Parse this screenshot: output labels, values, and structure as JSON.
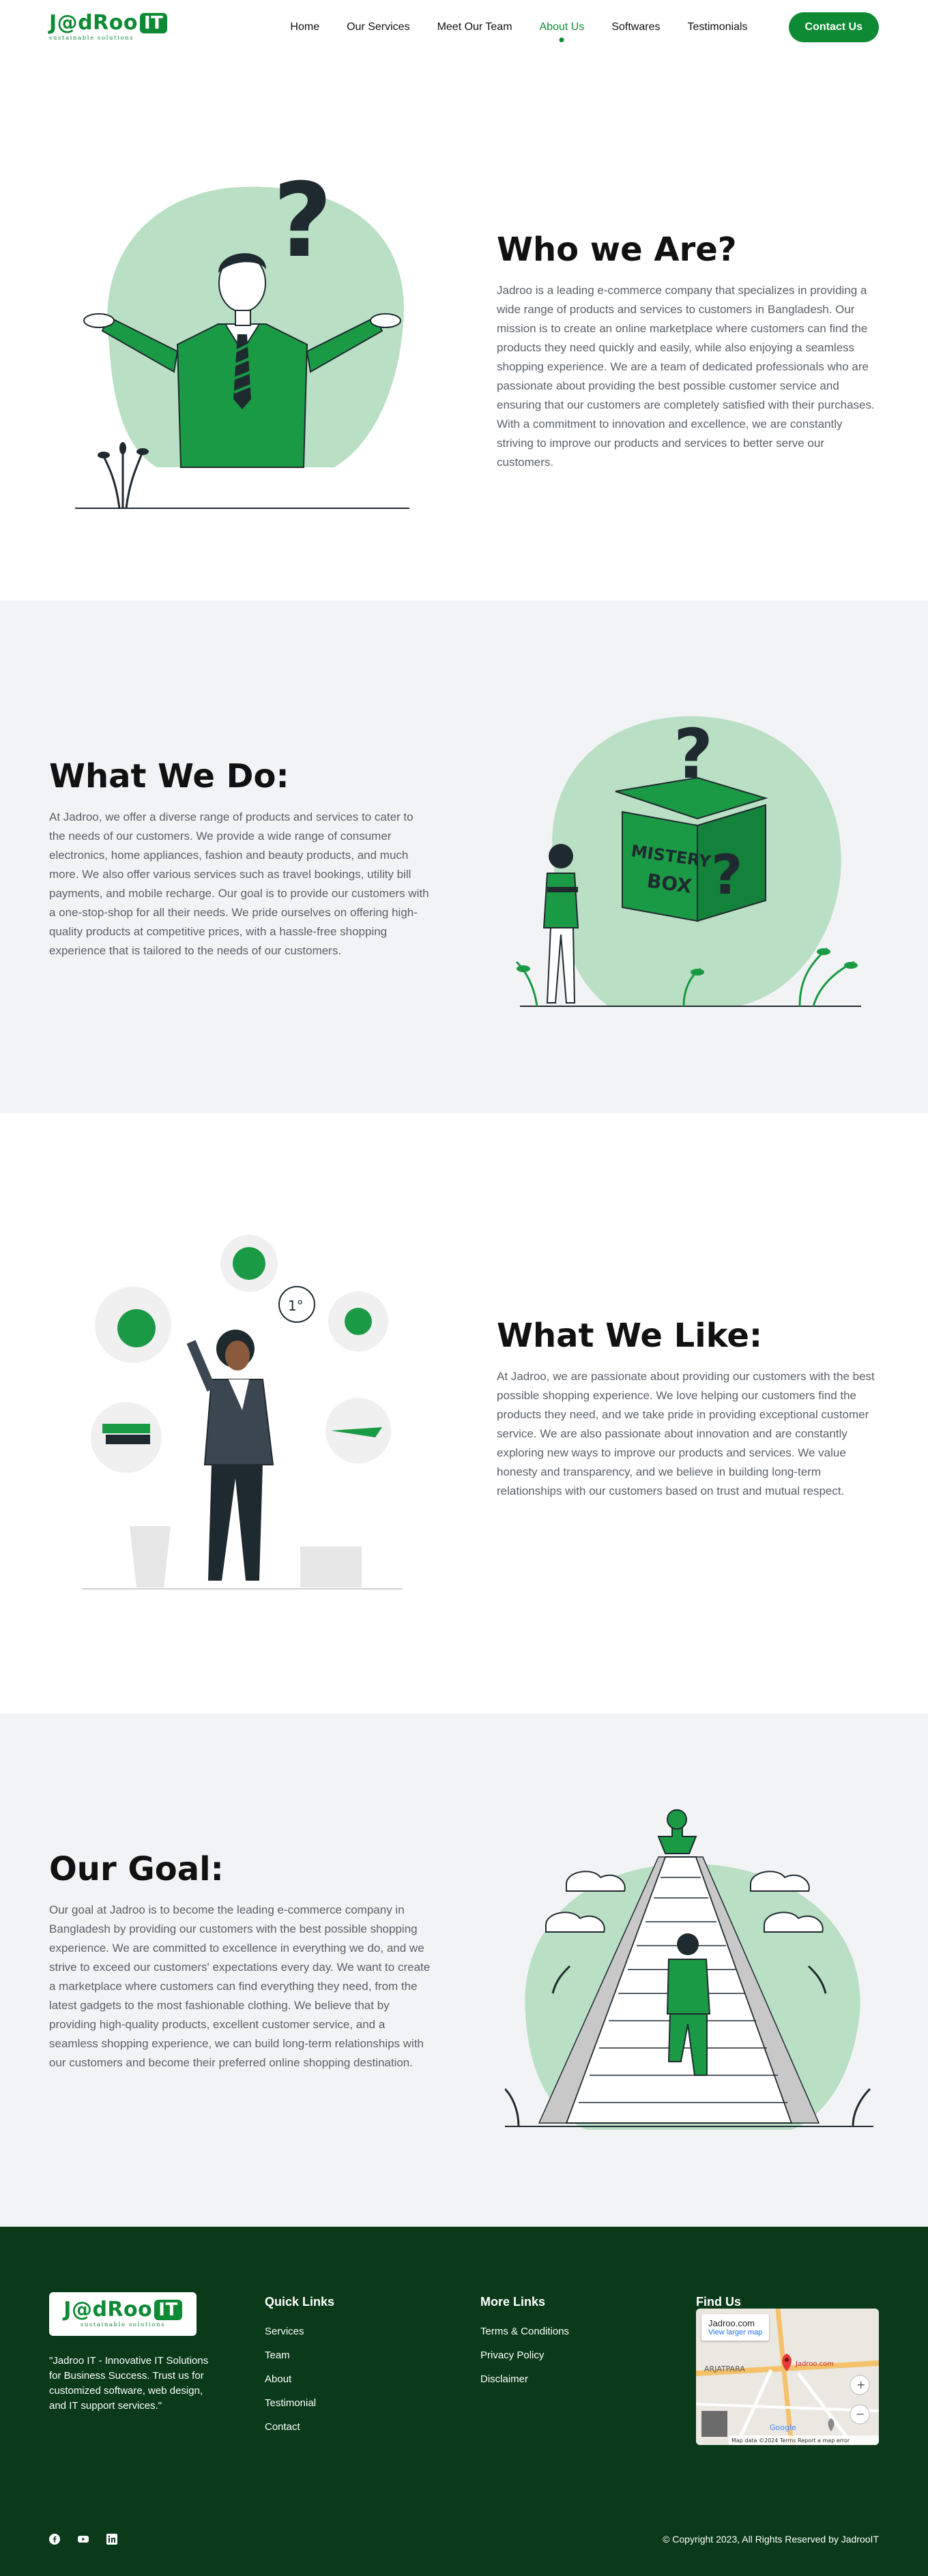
{
  "nav": {
    "logo_main": "J@dRoo",
    "logo_it": "IT",
    "logo_sub": "sustainable solutions",
    "links": [
      {
        "label": "Home"
      },
      {
        "label": "Our Services"
      },
      {
        "label": "Meet Our Team"
      },
      {
        "label": "About Us",
        "active": true
      },
      {
        "label": "Softwares"
      },
      {
        "label": "Testimonials"
      }
    ],
    "contact_button": "Contact Us"
  },
  "sections": {
    "who": {
      "title": "Who we Are?",
      "body": "Jadroo is a leading e-commerce company that specializes in providing a wide range of products and services to customers in Bangladesh. Our mission is to create an online marketplace where customers can find the products they need quickly and easily, while also enjoying a seamless shopping experience. We are a team of dedicated professionals who are passionate about providing the best possible customer service and ensuring that our customers are completely satisfied with their purchases. With a commitment to innovation and excellence, we are constantly striving to improve our products and services to better serve our customers."
    },
    "what_do": {
      "title": "What We Do:",
      "body": "At Jadroo, we offer a diverse range of products and services to cater to the needs of our customers. We provide a wide range of consumer electronics, home appliances, fashion and beauty products, and much more. We also offer various services such as travel bookings, utility bill payments, and mobile recharge. Our goal is to provide our customers with a one-stop-shop for all their needs. We pride ourselves on offering high-quality products at competitive prices, with a hassle-free shopping experience that is tailored to the needs of our customers.",
      "box_text_1": "MISTERY",
      "box_text_2": "BOX"
    },
    "what_like": {
      "title": "What We Like:",
      "body": "At Jadroo, we are passionate about providing our customers with the best possible shopping experience. We love helping our customers find the products they need, and we take pride in providing exceptional customer service. We are also passionate about innovation and are constantly exploring new ways to improve our products and services. We value honesty and transparency, and we believe in building long-term relationships with our customers based on trust and mutual respect.",
      "temp_label": "1°"
    },
    "goal": {
      "title": "Our Goal:",
      "body": "Our goal at Jadroo is to become the leading e-commerce company in Bangladesh by providing our customers with the best possible shopping experience. We are committed to excellence in everything we do, and we strive to exceed our customers' expectations every day. We want to create a marketplace where customers can find everything they need, from the latest gadgets to the most fashionable clothing. We believe that by providing high-quality products, excellent customer service, and a seamless shopping experience, we can build long-term relationships with our customers and become their preferred online shopping destination."
    }
  },
  "footer": {
    "description": "\"Jadroo IT - Innovative IT Solutions for Business Success. Trust us for customized software, web design, and IT support services.\"",
    "quick_links_title": "Quick Links",
    "quick_links": [
      "Services",
      "Team",
      "About",
      "Testimonial",
      "Contact"
    ],
    "more_links_title": "More Links",
    "more_links": [
      "Terms & Conditions",
      "Privacy Policy",
      "Disclaimer"
    ],
    "find_us_title": "Find Us",
    "map": {
      "place": "Jadroo.com",
      "larger_map": "View larger map",
      "pin_label": "Jadroo.com",
      "area_label": "ARJATPARA",
      "attribution": "Map data ©2024   Terms   Report a map error",
      "google": "Google"
    },
    "copyright": "© Copyright 2023, All Rights Reserved by JadrooIT"
  },
  "colors": {
    "brand": "#0e8a35",
    "footer_bg": "#0a3a1a",
    "section_alt_bg": "#f2f3f5",
    "illus_light": "#b9dfc4"
  }
}
